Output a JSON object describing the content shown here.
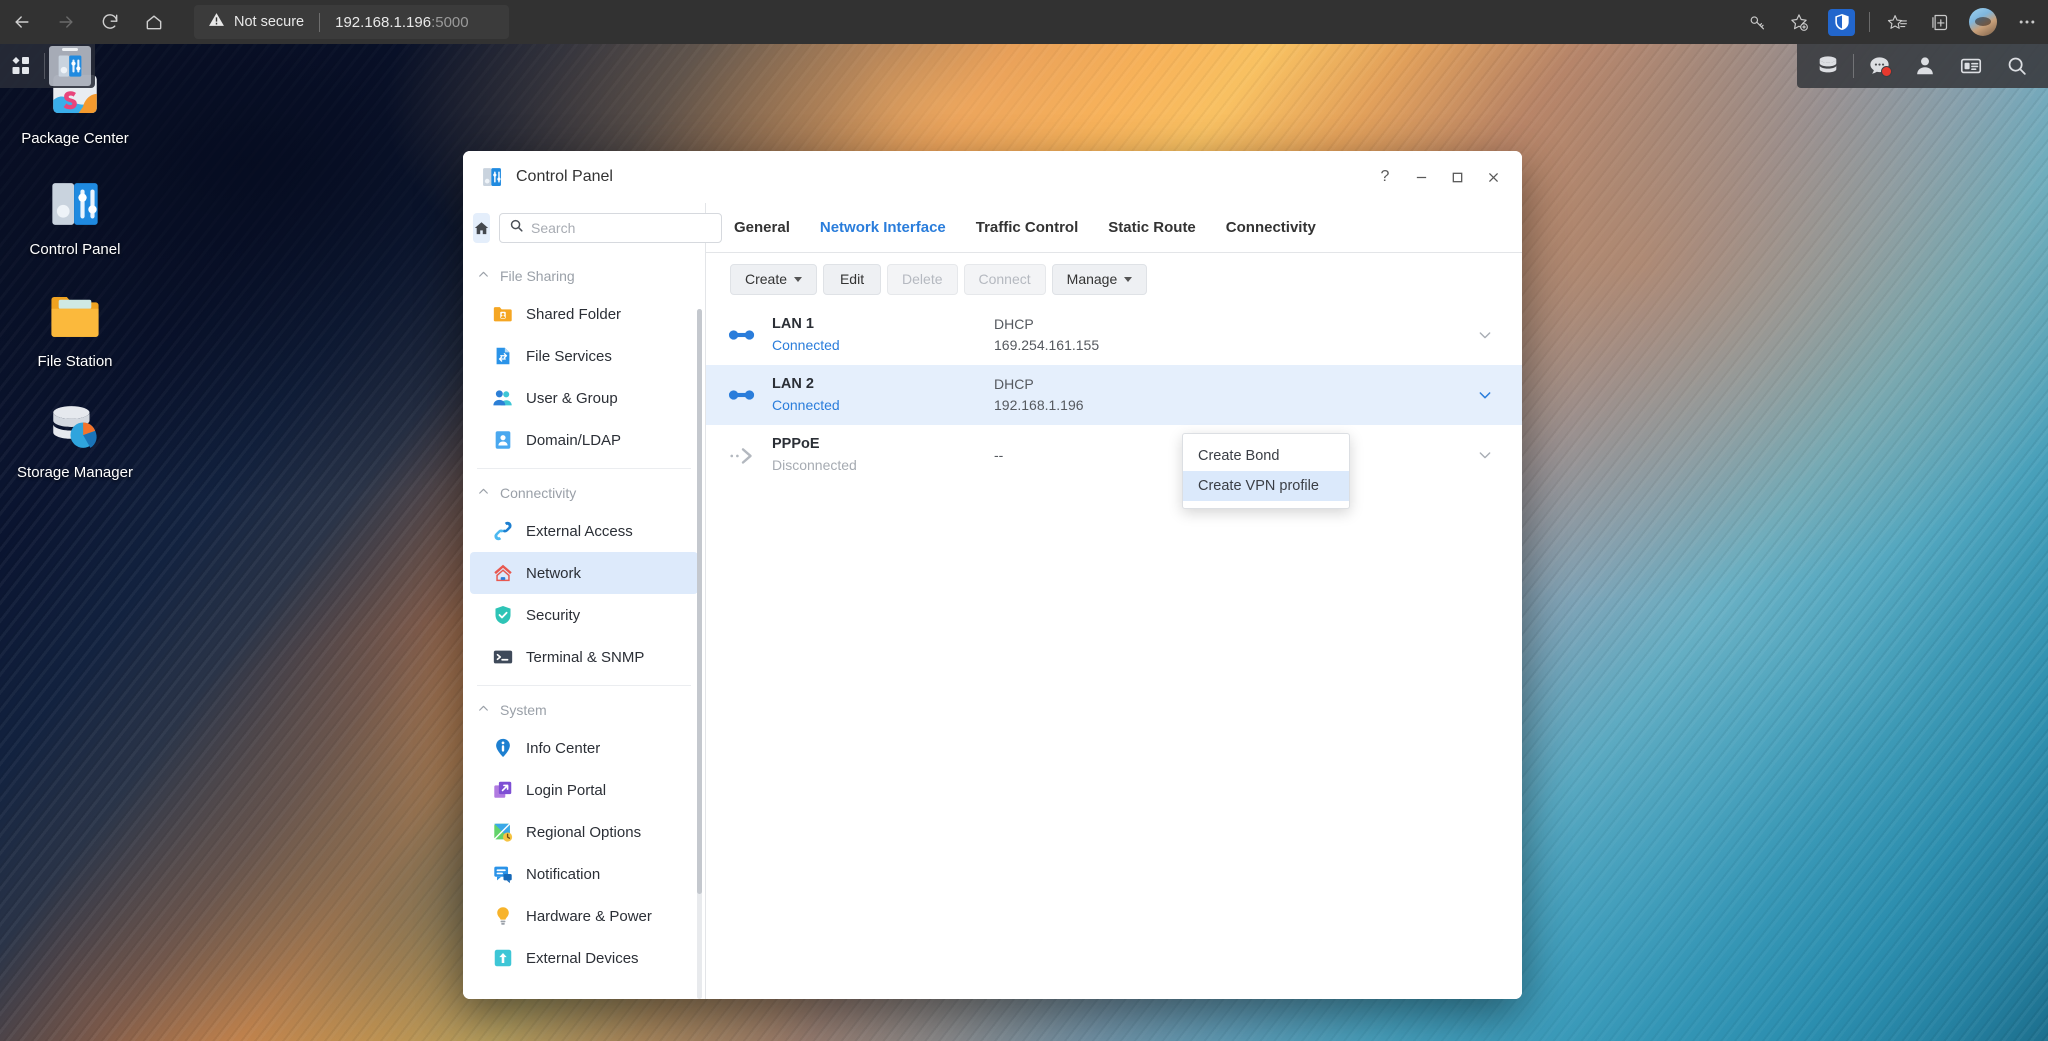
{
  "browser": {
    "nav": {
      "back": "back-arrow",
      "forward": "forward-arrow",
      "reload": "reload-icon",
      "home": "home-icon"
    },
    "security_label": "Not secure",
    "url_host": "192.168.1.196",
    "url_port": ":5000",
    "toolbar_icons": [
      "key-icon",
      "star-add-icon",
      "shield-icon",
      "favorites-icon",
      "collections-icon",
      "avatar",
      "settings-more-icon"
    ]
  },
  "dsm_taskbar": {
    "left_items": [
      {
        "name": "main-menu-icon",
        "label": "Main Menu"
      },
      {
        "name": "taskbar-app-control-panel",
        "label": "Control Panel"
      }
    ],
    "right_items": [
      {
        "name": "storage-icon",
        "label": "Storage"
      },
      {
        "name": "notifications-icon",
        "label": "Notifications",
        "badge": true
      },
      {
        "name": "user-icon",
        "label": "Options"
      },
      {
        "name": "widgets-icon",
        "label": "Widgets"
      },
      {
        "name": "search-icon",
        "label": "Search"
      }
    ]
  },
  "desktop_icons": [
    {
      "label": "Package Center",
      "icon": "package-center-icon"
    },
    {
      "label": "Control Panel",
      "icon": "control-panel-icon"
    },
    {
      "label": "File Station",
      "icon": "file-station-icon"
    },
    {
      "label": "Storage Manager",
      "icon": "storage-manager-icon"
    }
  ],
  "window": {
    "title": "Control Panel",
    "buttons": {
      "help": "?",
      "minimize": "–",
      "maximize": "❐",
      "close": "✕"
    }
  },
  "sidebar": {
    "search_placeholder": "Search",
    "search_value": "",
    "home_icon": "home-icon",
    "groups": [
      {
        "title": "File Sharing",
        "items": [
          {
            "label": "Shared Folder",
            "icon": "shared-folder-icon",
            "active": false
          },
          {
            "label": "File Services",
            "icon": "file-services-icon",
            "active": false
          },
          {
            "label": "User & Group",
            "icon": "user-group-icon",
            "active": false
          },
          {
            "label": "Domain/LDAP",
            "icon": "domain-ldap-icon",
            "active": false
          }
        ]
      },
      {
        "title": "Connectivity",
        "items": [
          {
            "label": "External Access",
            "icon": "external-access-icon",
            "active": false
          },
          {
            "label": "Network",
            "icon": "network-icon",
            "active": true
          },
          {
            "label": "Security",
            "icon": "security-icon",
            "active": false
          },
          {
            "label": "Terminal & SNMP",
            "icon": "terminal-snmp-icon",
            "active": false
          }
        ]
      },
      {
        "title": "System",
        "items": [
          {
            "label": "Info Center",
            "icon": "info-center-icon",
            "active": false
          },
          {
            "label": "Login Portal",
            "icon": "login-portal-icon",
            "active": false
          },
          {
            "label": "Regional Options",
            "icon": "regional-options-icon",
            "active": false
          },
          {
            "label": "Notification",
            "icon": "notification-icon",
            "active": false
          },
          {
            "label": "Hardware & Power",
            "icon": "hardware-power-icon",
            "active": false
          },
          {
            "label": "External Devices",
            "icon": "external-devices-icon",
            "active": false
          }
        ]
      }
    ]
  },
  "main": {
    "tabs": [
      {
        "label": "General",
        "active": false
      },
      {
        "label": "Network Interface",
        "active": true
      },
      {
        "label": "Traffic Control",
        "active": false
      },
      {
        "label": "Static Route",
        "active": false
      },
      {
        "label": "Connectivity",
        "active": false
      }
    ],
    "toolbar": [
      {
        "label": "Create",
        "caret": true,
        "disabled": false
      },
      {
        "label": "Edit",
        "caret": false,
        "disabled": false
      },
      {
        "label": "Delete",
        "caret": false,
        "disabled": true
      },
      {
        "label": "Connect",
        "caret": false,
        "disabled": true
      },
      {
        "label": "Manage",
        "caret": true,
        "disabled": false
      }
    ],
    "create_menu": [
      {
        "label": "Create Bond",
        "highlighted": false
      },
      {
        "label": "Create VPN profile",
        "highlighted": true
      }
    ],
    "interfaces": [
      {
        "name": "LAN 1",
        "status": "Connected",
        "status_state": "connected",
        "config": "DHCP",
        "address": "169.254.161.155",
        "icon": "lan-connected-icon",
        "selected": false
      },
      {
        "name": "LAN 2",
        "status": "Connected",
        "status_state": "connected",
        "config": "DHCP",
        "address": "192.168.1.196",
        "icon": "lan-connected-icon",
        "selected": true
      },
      {
        "name": "PPPoE",
        "status": "Disconnected",
        "status_state": "disconnected",
        "config": "",
        "address": "--",
        "icon": "pppoe-icon",
        "selected": false
      }
    ]
  },
  "colors": {
    "accent": "#2a7ddb",
    "selected_row": "#e5effc",
    "sidebar_active": "#ddeafb",
    "menu_highlight": "#dbe9fb",
    "browser_chrome": "#323232",
    "notification_badge": "#e8392e"
  }
}
